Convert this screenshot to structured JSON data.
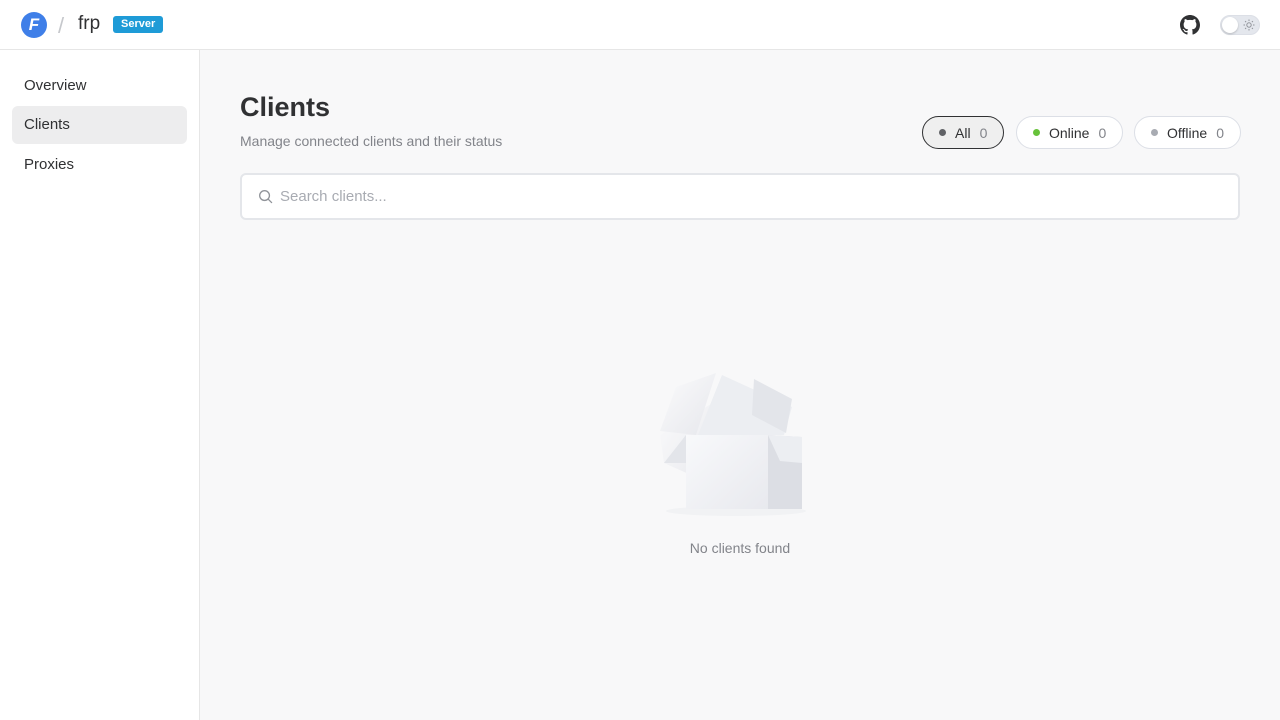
{
  "header": {
    "app_name": "frp",
    "badge": "Server",
    "logo_letter": "F",
    "github_icon": "github-icon",
    "theme_toggle_icon": "sun-icon"
  },
  "sidebar": {
    "items": [
      {
        "label": "Overview",
        "active": false
      },
      {
        "label": "Clients",
        "active": true
      },
      {
        "label": "Proxies",
        "active": false
      }
    ]
  },
  "main": {
    "title": "Clients",
    "subtitle": "Manage connected clients and their status",
    "filters": [
      {
        "label": "All",
        "count": "0",
        "dot_color": "#606266",
        "active": true
      },
      {
        "label": "Online",
        "count": "0",
        "dot_color": "#67c23a",
        "active": false
      },
      {
        "label": "Offline",
        "count": "0",
        "dot_color": "#a8abb2",
        "active": false
      }
    ],
    "search": {
      "placeholder": "Search clients...",
      "value": ""
    },
    "empty_state": {
      "text": "No clients found",
      "icon": "empty-box-icon"
    }
  },
  "colors": {
    "brand": "#3f7fe8",
    "badge": "#1e9bd7",
    "online": "#67c23a",
    "offline": "#a8abb2"
  }
}
